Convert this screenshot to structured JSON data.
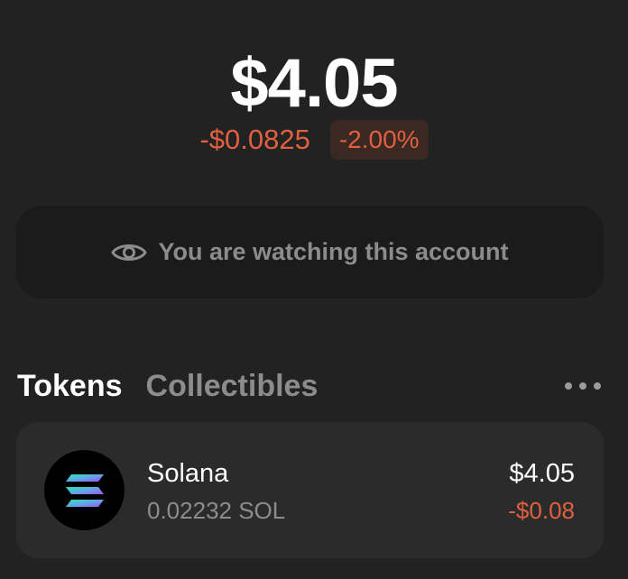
{
  "portfolio": {
    "balance": "$4.05",
    "change_amount": "-$0.0825",
    "change_percent": "-2.00%"
  },
  "watch_banner": {
    "icon": "eye-icon",
    "text": "You are watching this account"
  },
  "tabs": [
    {
      "label": "Tokens",
      "active": true
    },
    {
      "label": "Collectibles",
      "active": false
    }
  ],
  "more_menu": {
    "icon": "more-horizontal-icon"
  },
  "tokens": [
    {
      "name": "Solana",
      "balance": "0.02232 SOL",
      "value": "$4.05",
      "change": "-$0.08",
      "icon": "solana-logo"
    }
  ],
  "colors": {
    "background": "#222222",
    "card": "#2b2b2b",
    "banner": "#1b1b1b",
    "negative": "#e0603f",
    "negative_badge_bg": "#3a2822",
    "muted_text": "#8c8c8c"
  }
}
